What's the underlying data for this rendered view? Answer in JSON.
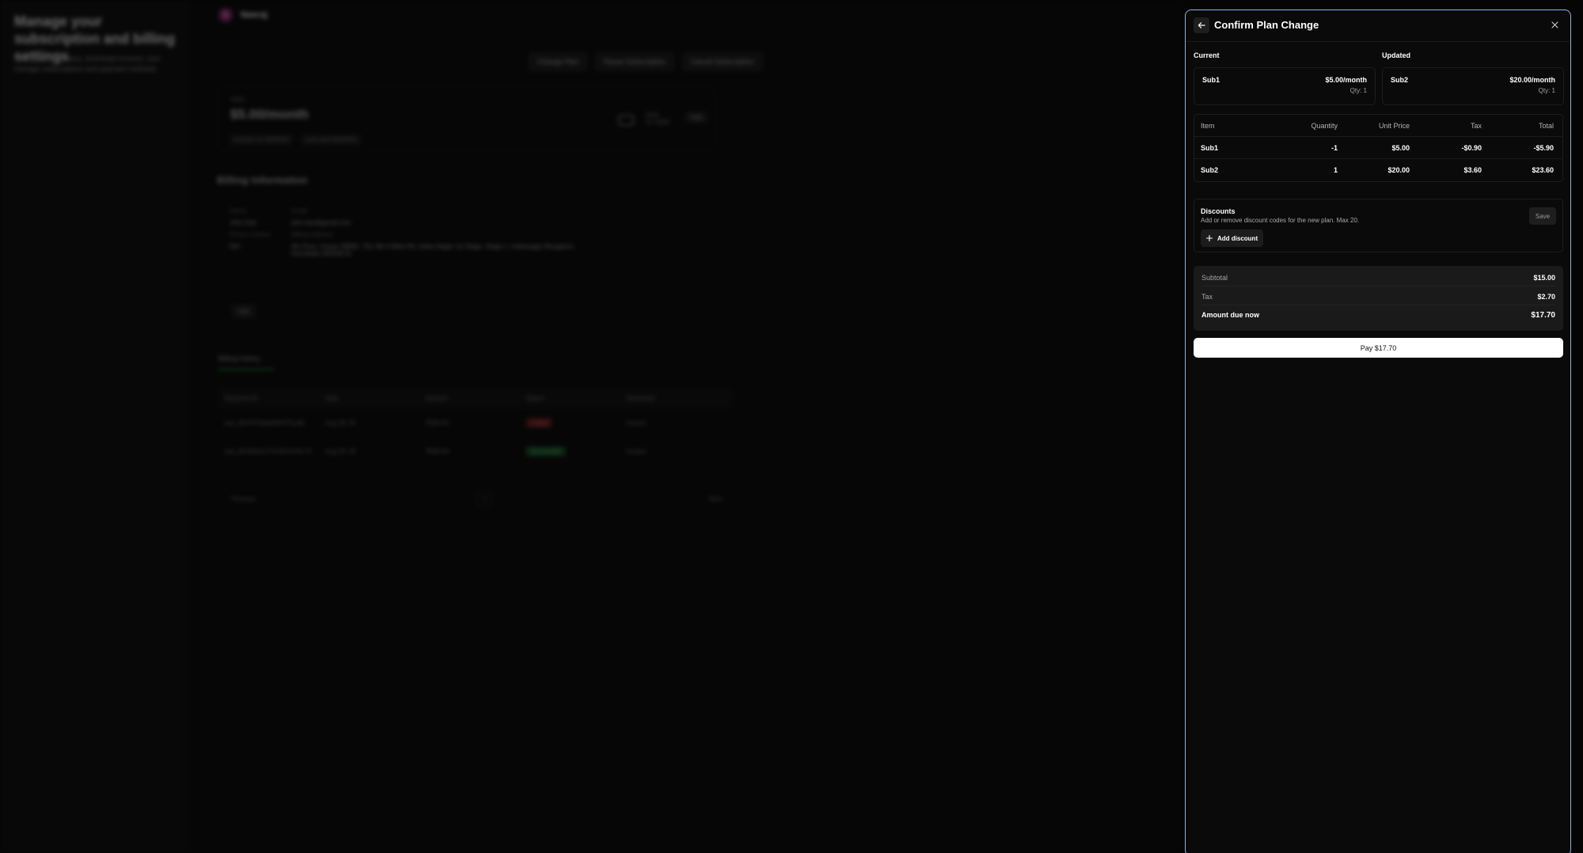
{
  "background": {
    "heading": "Manage your subscription and billing settings",
    "subheading": "View payment history, download invoices, and manage subscriptions and payment methods.",
    "user": {
      "initial": "N",
      "name": "Neeraj"
    },
    "actions": [
      "Change Plan",
      "Pause Subscription",
      "Cancel Subscription"
    ],
    "plan": {
      "label": "Sub1",
      "price": "$5.00/month",
      "renews": "renews on 09/28/25",
      "last": "Last paid 08/28/25",
      "card": "Card",
      "card_number": "•••• 4242",
      "edit": "Edit"
    },
    "billing_title": "Billing Information",
    "billing_info": [
      {
        "key": "Name",
        "value": "John Doe"
      },
      {
        "key": "Email",
        "value": "john.doe@gmail.com"
      },
      {
        "key": "Phone number",
        "value": "N/A"
      },
      {
        "key": "Billing Address",
        "value": "4th Floor, Vuuwe #8836, 726, 8th A Main Rd, Indira Nagar 1st Stage, Stage 1, Indiranagar Bengaluru, Karnataka 560038 IN"
      }
    ],
    "edit_button": "Edit",
    "tab": "Billing history",
    "table_headers": [
      "Payment ID",
      "Date",
      "Amount",
      "Status",
      "Download"
    ],
    "table_rows": [
      {
        "id": "pay_BHr9Y0d4pIbKKTKoaB",
        "date": "Aug 28, 25",
        "amount": "₹584.42",
        "status": "Failed",
        "download": "Invoice"
      },
      {
        "id": "pay_BHrk6ScvTVCM7eOHL7X",
        "date": "Aug 28, 25",
        "amount": "₹584.40",
        "status": "Successful",
        "download": "Invoice"
      }
    ],
    "pager": {
      "previous": "Previous",
      "page": "1",
      "next": "Next"
    }
  },
  "panel": {
    "title": "Confirm Plan Change",
    "current_label": "Current",
    "updated_label": "Updated",
    "current_plan": {
      "name": "Sub1",
      "price": "$5.00/month",
      "qty": "Qty: 1"
    },
    "updated_plan": {
      "name": "Sub2",
      "price": "$20.00/month",
      "qty": "Qty: 1"
    },
    "table": {
      "headers": {
        "item": "Item",
        "quantity": "Quantity",
        "unit_price": "Unit Price",
        "tax": "Tax",
        "total": "Total"
      },
      "rows": [
        {
          "item": "Sub1",
          "quantity": "-1",
          "unit_price": "$5.00",
          "tax": "-$0.90",
          "total": "-$5.90"
        },
        {
          "item": "Sub2",
          "quantity": "1",
          "unit_price": "$20.00",
          "tax": "$3.60",
          "total": "$23.60"
        }
      ]
    },
    "discounts": {
      "title": "Discounts",
      "description": "Add or remove discount codes for the new plan. Max 20.",
      "save": "Save",
      "add": "Add discount"
    },
    "summary": {
      "subtotal_label": "Subtotal",
      "subtotal": "$15.00",
      "tax_label": "Tax",
      "tax": "$2.70",
      "due_label": "Amount due now",
      "due": "$17.70"
    },
    "pay_button": "Pay $17.70"
  }
}
